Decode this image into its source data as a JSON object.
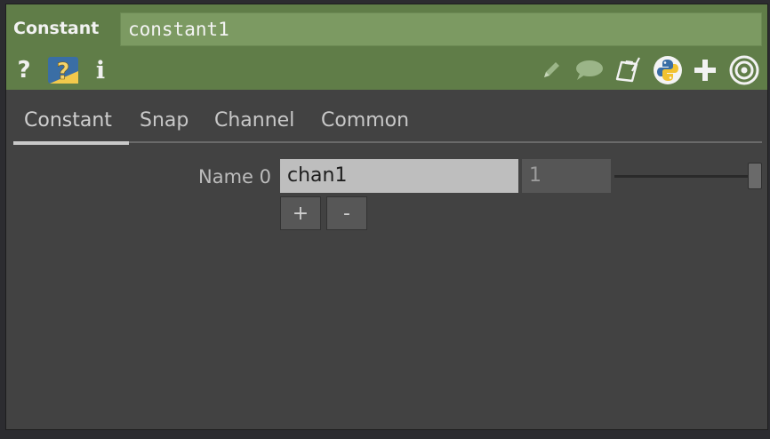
{
  "header": {
    "op_type": "Constant",
    "op_name": "constant1",
    "left_icons": [
      "help-icon",
      "python-help-icon",
      "info-icon"
    ],
    "left_icon_labels": {
      "help": "?",
      "info": "i"
    },
    "right_icons": [
      "edit-pencil-icon",
      "comment-icon",
      "clipboard-icon",
      "python-icon",
      "add-icon",
      "target-icon"
    ]
  },
  "tabs": [
    {
      "label": "Constant",
      "active": true
    },
    {
      "label": "Snap",
      "active": false
    },
    {
      "label": "Channel",
      "active": false
    },
    {
      "label": "Common",
      "active": false
    }
  ],
  "params": {
    "name0_label": "Name 0",
    "name0_value": "chan1",
    "value0": "1",
    "add_label": "+",
    "remove_label": "-"
  },
  "colors": {
    "header_bg": "#607d48",
    "name_field_bg": "#7c9a62",
    "panel_bg": "#424242"
  }
}
